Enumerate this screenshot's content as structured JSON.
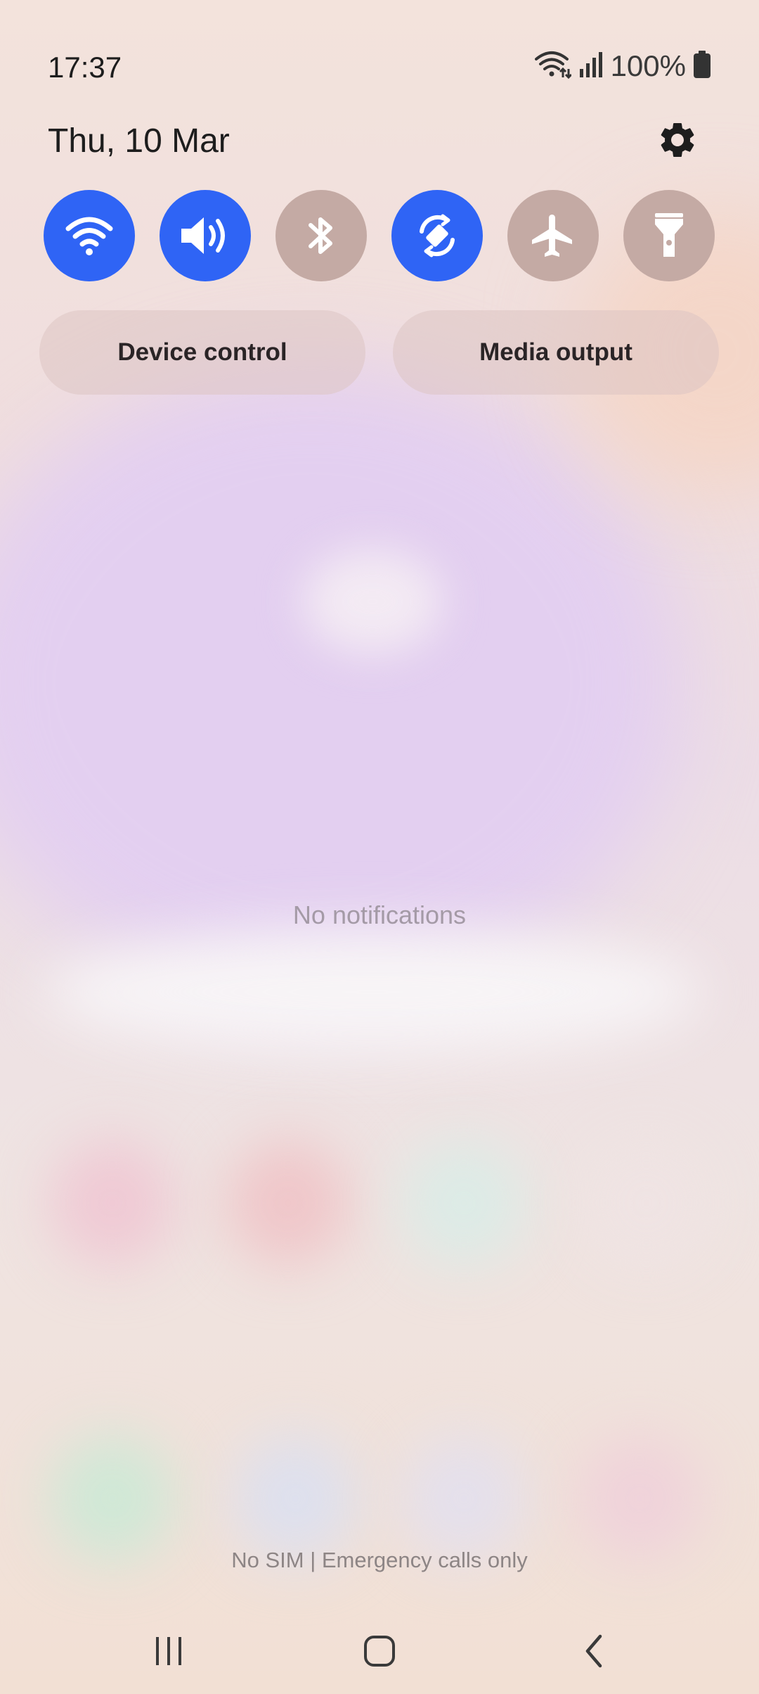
{
  "status_bar": {
    "time": "17:37",
    "battery_percent": "100%",
    "icons": [
      "wifi-upload-icon",
      "cell-signal-icon",
      "battery-full-icon"
    ]
  },
  "header": {
    "date": "Thu, 10 Mar",
    "settings_icon": "gear-icon"
  },
  "quick_settings": [
    {
      "id": "wifi",
      "icon": "wifi-icon",
      "state": "on"
    },
    {
      "id": "sound",
      "icon": "volume-icon",
      "state": "on"
    },
    {
      "id": "bluetooth",
      "icon": "bluetooth-icon",
      "state": "off"
    },
    {
      "id": "auto-rotate",
      "icon": "auto-rotate-icon",
      "state": "on"
    },
    {
      "id": "airplane",
      "icon": "airplane-icon",
      "state": "off"
    },
    {
      "id": "flashlight",
      "icon": "flashlight-icon",
      "state": "off"
    }
  ],
  "buttons": {
    "device_control": "Device control",
    "media_output": "Media output"
  },
  "notifications": {
    "empty_text": "No notifications"
  },
  "footer": {
    "carrier_text": "No SIM | Emergency calls only"
  },
  "colors": {
    "tile_on": "#2f64f5",
    "tile_off": "#c4aaa4"
  }
}
